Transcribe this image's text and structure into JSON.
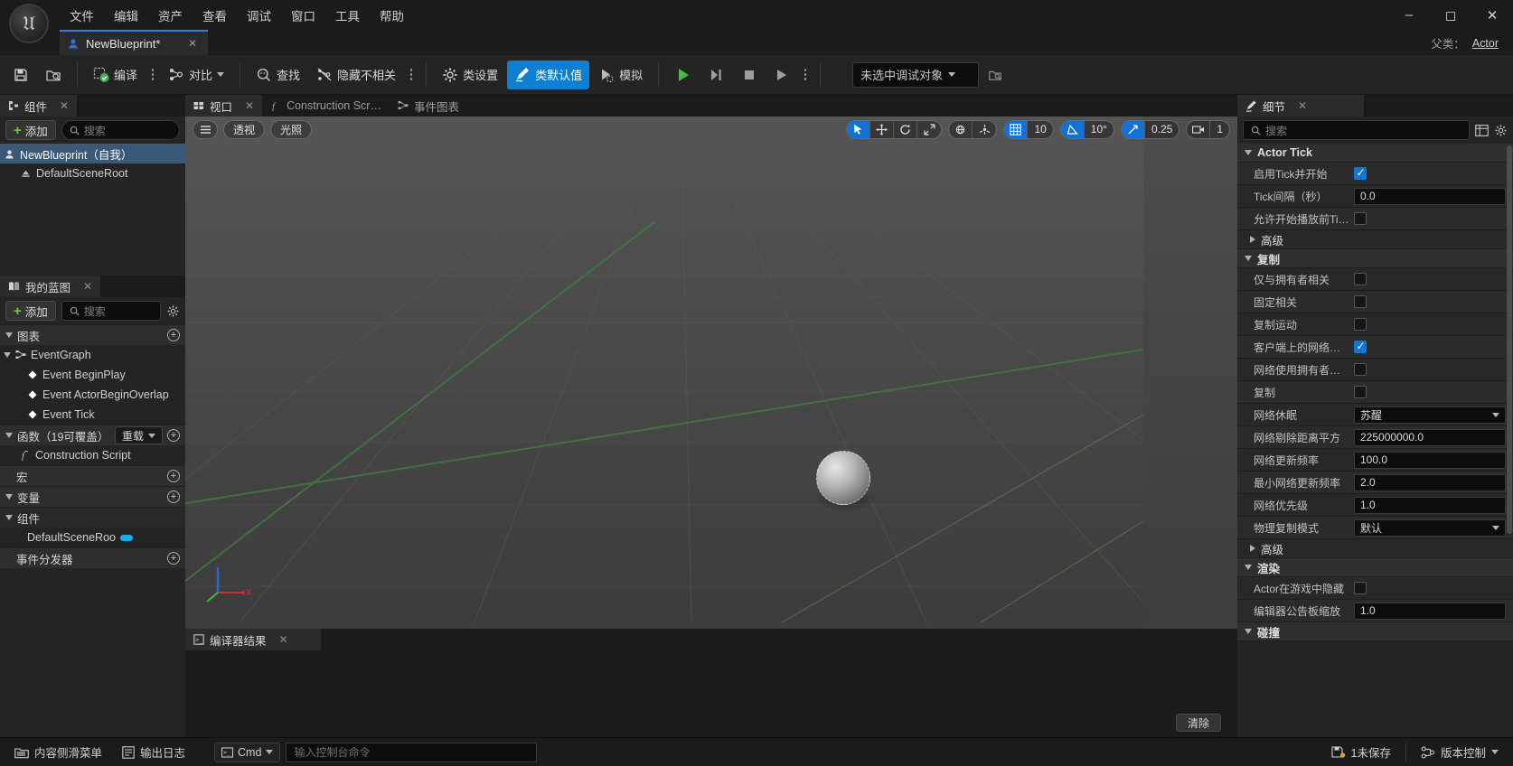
{
  "window": {
    "logo": "unreal-engine-logo",
    "minimize": "–",
    "maximize": "▢",
    "close": "✕"
  },
  "menubar": {
    "items": [
      "文件",
      "编辑",
      "资产",
      "查看",
      "调试",
      "窗口",
      "工具",
      "帮助"
    ]
  },
  "asset_tab": {
    "label": "NewBlueprint*",
    "close": "✕"
  },
  "parent_class": {
    "label": "父类：",
    "value": "Actor"
  },
  "toolbar": {
    "save_label": "",
    "compile_label": "编译",
    "diff_label": "对比",
    "find_label": "查找",
    "hide_unrelated_label": "隐藏不相关",
    "class_settings_label": "类设置",
    "class_defaults_label": "类默认值",
    "simulate_label": "模拟",
    "debug_object": "未选中调试对象"
  },
  "components_panel": {
    "tab_label": "组件",
    "close": "✕",
    "add_label": "添加",
    "search_placeholder": "搜索",
    "items": [
      {
        "label": "NewBlueprint（自我）",
        "selected": true
      },
      {
        "label": "DefaultSceneRoot",
        "selected": false
      }
    ]
  },
  "myblueprint_panel": {
    "tab_label": "我的蓝图",
    "close": "✕",
    "add_label": "添加",
    "search_placeholder": "搜索",
    "sections": {
      "graphs": "图表",
      "eventgraph": "EventGraph",
      "events": [
        "Event BeginPlay",
        "Event ActorBeginOverlap",
        "Event Tick"
      ],
      "functions": "函数（19可覆盖）",
      "override_label": "重载",
      "construction_script": "Construction Script",
      "macros": "宏",
      "variables": "变量",
      "components": "组件",
      "component_item": "DefaultSceneRoo",
      "event_dispatchers": "事件分发器"
    }
  },
  "center_tabs": [
    {
      "label": "视口",
      "icon": "viewport-icon",
      "active": true,
      "close": "✕"
    },
    {
      "label": "Construction Scr…",
      "icon": "function-icon",
      "active": false
    },
    {
      "label": "事件图表",
      "icon": "graph-icon",
      "active": false
    }
  ],
  "viewport": {
    "menu_icon": "hamburger-icon",
    "perspective": "透视",
    "lit": "光照",
    "tools": [
      "select-icon",
      "move-icon",
      "rotate-icon",
      "scale-icon"
    ],
    "coord_icons": [
      "world-coords-icon",
      "snap-to-icon"
    ],
    "grid_snap": "10",
    "angle_snap": "10°",
    "scale_snap": "0.25",
    "camera_speed": "1",
    "axis_x": "X"
  },
  "compiler_panel": {
    "tab_label": "编译器结果",
    "close": "✕",
    "clear_label": "清除"
  },
  "details_panel": {
    "tab_label": "细节",
    "close": "✕",
    "search_placeholder": "搜索",
    "columns_icon": "columns-icon",
    "settings_icon": "gear-icon",
    "categories": [
      {
        "name": "Actor Tick",
        "expanded": true,
        "rows": [
          {
            "label": "启用Tick并开始",
            "type": "checkbox",
            "value": true
          },
          {
            "label": "Tick间隔（秒）",
            "type": "text",
            "value": "0.0"
          },
          {
            "label": "允许开始播放前Ti…",
            "type": "checkbox",
            "value": false
          },
          {
            "label": "高级",
            "type": "subcategory",
            "expanded": false
          }
        ]
      },
      {
        "name": "复制",
        "expanded": true,
        "rows": [
          {
            "label": "仅与拥有者相关",
            "type": "checkbox",
            "value": false
          },
          {
            "label": "固定相关",
            "type": "checkbox",
            "value": false
          },
          {
            "label": "复制运动",
            "type": "checkbox",
            "value": false
          },
          {
            "label": "客户端上的网络…",
            "type": "checkbox",
            "value": true
          },
          {
            "label": "网络使用拥有者…",
            "type": "checkbox",
            "value": false
          },
          {
            "label": "复制",
            "type": "checkbox",
            "value": false
          },
          {
            "label": "网络休眠",
            "type": "select",
            "value": "苏醒"
          },
          {
            "label": "网络剔除距离平方",
            "type": "text",
            "value": "225000000.0"
          },
          {
            "label": "网络更新频率",
            "type": "text",
            "value": "100.0"
          },
          {
            "label": "最小网络更新频率",
            "type": "text",
            "value": "2.0"
          },
          {
            "label": "网络优先级",
            "type": "text",
            "value": "1.0"
          },
          {
            "label": "物理复制模式",
            "type": "select",
            "value": "默认"
          },
          {
            "label": "高级",
            "type": "subcategory",
            "expanded": false
          }
        ]
      },
      {
        "name": "渲染",
        "expanded": true,
        "rows": [
          {
            "label": "Actor在游戏中隐藏",
            "type": "checkbox",
            "value": false
          },
          {
            "label": "编辑器公告板缩放",
            "type": "text",
            "value": "1.0"
          }
        ]
      },
      {
        "name": "碰撞",
        "expanded": true,
        "rows": []
      }
    ]
  },
  "statusbar": {
    "content_drawer": "内容侧滑菜单",
    "output_log": "输出日志",
    "cmd_label": "Cmd",
    "console_placeholder": "输入控制台命令",
    "unsaved": "1未保存",
    "source_control": "版本控制"
  }
}
